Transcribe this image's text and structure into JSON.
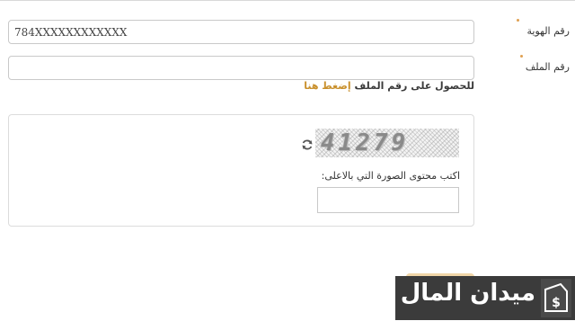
{
  "form": {
    "id_number": {
      "label": "رقم الهوية",
      "value": "784XXXXXXXXXXXX"
    },
    "file_number": {
      "label": "رقم الملف",
      "value": ""
    },
    "help": {
      "text": "للحصول على رقم الملف",
      "link": "إضغط هنا"
    }
  },
  "captcha": {
    "image_text": "41279",
    "label": "اكتب محتوى الصورة التي بالاعلى:",
    "input_value": "",
    "refresh_icon": "refresh-icon"
  },
  "watermark": {
    "text": "ميدان المال",
    "icon": "money-icon"
  },
  "colors": {
    "accent": "#c9902c",
    "required_dot": "#e0a050",
    "border": "#c9c9c9",
    "watermark_bg": "#3b3b3b"
  }
}
